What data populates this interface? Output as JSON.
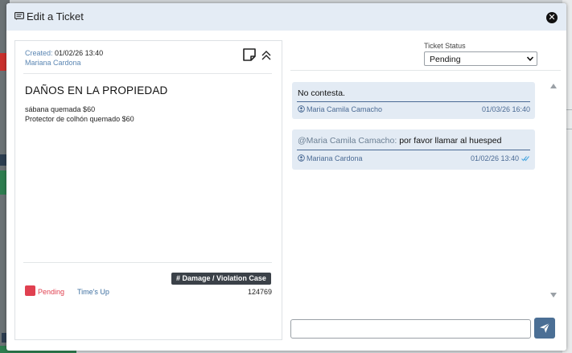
{
  "modal": {
    "title": "Edit a Ticket",
    "close_symbol": "✕"
  },
  "ticket": {
    "created_label": "Created:",
    "created_date": "01/02/26 13:40",
    "creator": "Mariana Cardona",
    "title": "DAÑOS EN LA PROPIEDAD",
    "description_lines": [
      "sábana quemada $60",
      "Protector de colhón quemado $60"
    ],
    "category": "# Damage / Violation Case",
    "status": "Pending",
    "timer_label": "Time's Up",
    "id": "124769",
    "status_color": "#e04050"
  },
  "status_panel": {
    "label": "Ticket Status",
    "selected": "Pending"
  },
  "comments": [
    {
      "mention": "",
      "text": "No contesta.",
      "author": "Maria Camila Camacho",
      "time": "01/03/26 16:40"
    },
    {
      "mention": "@Maria Camila Camacho:",
      "text": " por favor llamar al huesped",
      "author": "Mariana Cardona",
      "time": "01/02/26 13:40"
    }
  ],
  "composer": {
    "placeholder": ""
  },
  "icons": {
    "title": "message-square-icon",
    "note": "sticky-note-icon",
    "collapse": "double-chevron-up-icon",
    "author": "user-circle-icon",
    "read": "double-check-icon",
    "send": "paper-plane-icon"
  },
  "colors": {
    "header_bg": "#e4ecf5",
    "comment_bg": "#e3ebf4",
    "accent": "#4b6f95",
    "tag_bg": "#3b4148"
  }
}
